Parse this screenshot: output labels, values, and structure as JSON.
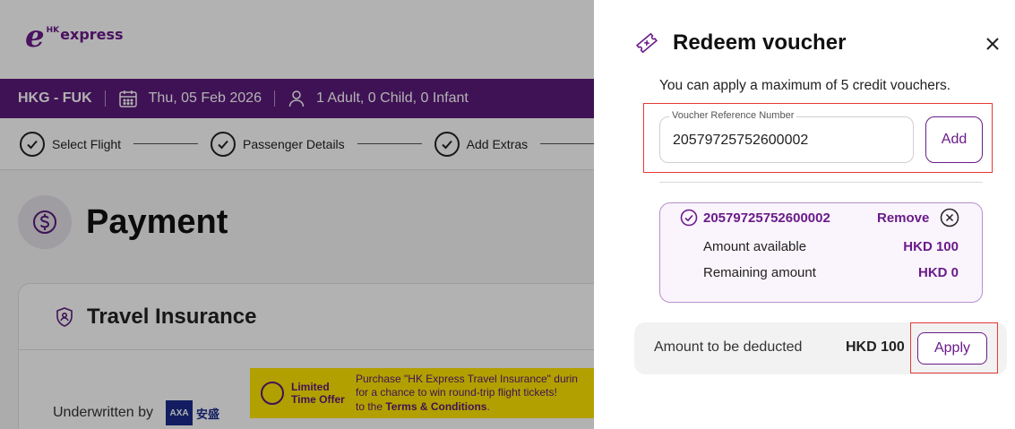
{
  "brand": {
    "logo_mark": "e",
    "logo_prefix": "HK",
    "logo_name": "express",
    "color": "#6a1b8a"
  },
  "trip": {
    "route": "HKG - FUK",
    "date": "Thu, 05 Feb 2026",
    "passengers": "1 Adult, 0 Child, 0 Infant"
  },
  "steps": [
    {
      "label": "Select Flight",
      "done": true
    },
    {
      "label": "Passenger Details",
      "done": true
    },
    {
      "label": "Add Extras",
      "done": true
    }
  ],
  "page": {
    "title": "Payment"
  },
  "insurance": {
    "title": "Travel Insurance",
    "underwritten_by": "Underwritten by",
    "insurer_logo": "AXA",
    "insurer_cn": "安盛",
    "promo_tag_line1": "Limited",
    "promo_tag_line2": "Time Offer",
    "promo_line1": "Purchase \"HK Express Travel Insurance\" durin",
    "promo_line2": "for a chance to win round-trip flight tickets!",
    "promo_line3_prefix": "to the ",
    "promo_line3_link": "Terms & Conditions",
    "promo_line3_suffix": "."
  },
  "drawer": {
    "title": "Redeem voucher",
    "note": "You can apply a maximum of 5 credit vouchers.",
    "input_label": "Voucher Reference Number",
    "input_value": "20579725752600002",
    "add_label": "Add",
    "voucher": {
      "code": "20579725752600002",
      "remove_label": "Remove",
      "available_label": "Amount available",
      "available_value": "HKD 100",
      "remaining_label": "Remaining amount",
      "remaining_value": "HKD 0"
    },
    "deduct_label": "Amount to be deducted",
    "deduct_value": "HKD 100",
    "apply_label": "Apply"
  },
  "colors": {
    "accent": "#6a1b8a",
    "trip_bar": "#5b1a7a",
    "highlight": "#e53935",
    "promo": "#ffe600"
  }
}
